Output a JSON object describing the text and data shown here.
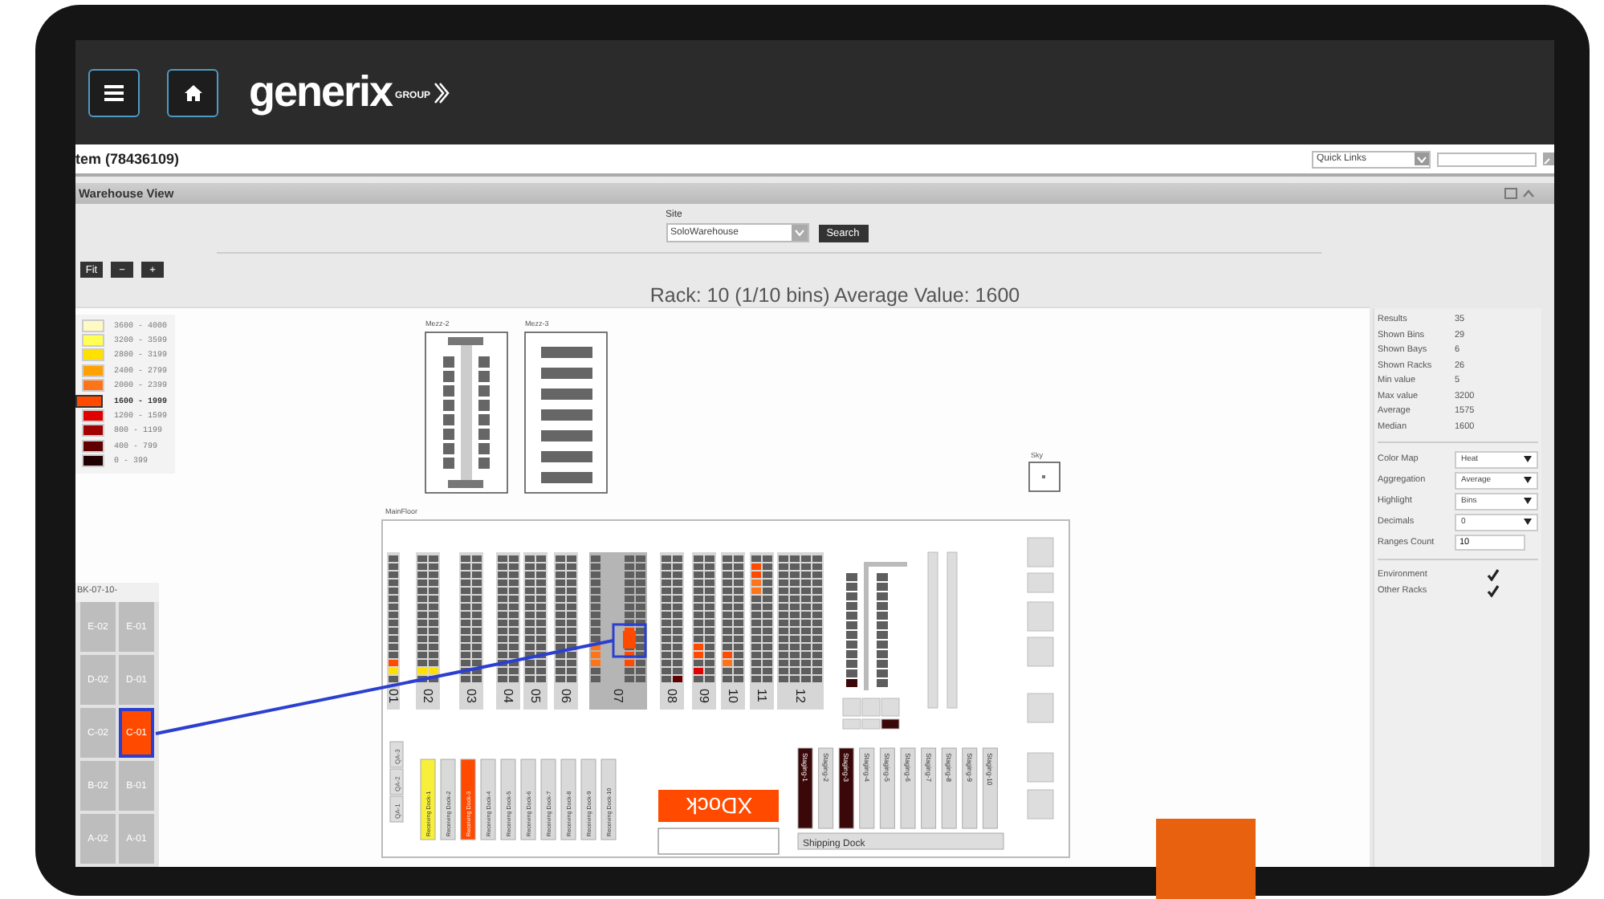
{
  "header": {
    "logo": "generix",
    "logo_suffix": "GROUP"
  },
  "title_bar": {
    "title": "tem (78436109)",
    "quick_links": "Quick Links"
  },
  "panel": {
    "title": "Warehouse View"
  },
  "site": {
    "label": "Site",
    "value": "SoloWarehouse",
    "button": "Search"
  },
  "zoom_buttons": [
    "Fit",
    "−",
    "+"
  ],
  "rack_title": "Rack: 10 (1/10 bins)  Average Value: 1600",
  "legend": [
    {
      "range": "3600 - 4000",
      "color": "#fff9c4",
      "selected": false
    },
    {
      "range": "3200 - 3599",
      "color": "#ffff55",
      "selected": false
    },
    {
      "range": "2800 - 3199",
      "color": "#ffe000",
      "selected": false
    },
    {
      "range": "2400 - 2799",
      "color": "#ffa200",
      "selected": false
    },
    {
      "range": "2000 - 2399",
      "color": "#ff7418",
      "selected": false
    },
    {
      "range": "1600 - 1999",
      "color": "#ff4a00",
      "selected": true
    },
    {
      "range": "1200 - 1599",
      "color": "#e00000",
      "selected": false
    },
    {
      "range": "800 - 1199",
      "color": "#a00000",
      "selected": false
    },
    {
      "range": "400 - 799",
      "color": "#600000",
      "selected": false
    },
    {
      "range": "0 - 399",
      "color": "#200000",
      "selected": false
    }
  ],
  "bin_detail": {
    "title": "BK-07-10-",
    "bins": [
      {
        "label": "E-02",
        "selected": false
      },
      {
        "label": "E-01",
        "selected": false
      },
      {
        "label": "D-02",
        "selected": false
      },
      {
        "label": "D-01",
        "selected": false
      },
      {
        "label": "C-02",
        "selected": false
      },
      {
        "label": "C-01",
        "selected": true
      },
      {
        "label": "B-02",
        "selected": false
      },
      {
        "label": "B-01",
        "selected": false
      },
      {
        "label": "A-02",
        "selected": false
      },
      {
        "label": "A-01",
        "selected": false
      }
    ]
  },
  "map": {
    "mezzanines": [
      "Mezz-2",
      "Mezz-3"
    ],
    "sky": "Sky",
    "floor_label": "MainFloor",
    "aisles": [
      "01",
      "02",
      "03",
      "04",
      "05",
      "06",
      "07",
      "08",
      "09",
      "10",
      "11",
      "12"
    ],
    "qa": [
      "QA-1",
      "QA-2",
      "QA-3"
    ],
    "receiving": [
      {
        "label": "Receiving Dock-1",
        "color": "#f6f03a"
      },
      {
        "label": "Receiving Dock-2",
        "color": "#d9d9d9"
      },
      {
        "label": "Receiving Dock-3",
        "color": "#ff4a00"
      },
      {
        "label": "Receiving Dock-4",
        "color": "#d9d9d9"
      },
      {
        "label": "Receiving Dock-5",
        "color": "#d9d9d9"
      },
      {
        "label": "Receiving Dock-6",
        "color": "#d9d9d9"
      },
      {
        "label": "Receiving Dock-7",
        "color": "#d9d9d9"
      },
      {
        "label": "Receiving Dock-8",
        "color": "#d9d9d9"
      },
      {
        "label": "Receiving Dock-9",
        "color": "#d9d9d9"
      },
      {
        "label": "Receiving Dock-10",
        "color": "#d9d9d9"
      }
    ],
    "xdock": "XDock",
    "staging": [
      {
        "label": "Staging-1",
        "color": "#3a0808"
      },
      {
        "label": "Staging-2",
        "color": "#d9d9d9"
      },
      {
        "label": "Staging-3",
        "color": "#3a0808"
      },
      {
        "label": "Staging-4",
        "color": "#d9d9d9"
      },
      {
        "label": "Staging-5",
        "color": "#d9d9d9"
      },
      {
        "label": "Staging-6",
        "color": "#d9d9d9"
      },
      {
        "label": "Staging-7",
        "color": "#d9d9d9"
      },
      {
        "label": "Staging-8",
        "color": "#d9d9d9"
      },
      {
        "label": "Staging-9",
        "color": "#d9d9d9"
      },
      {
        "label": "Staging-10",
        "color": "#d9d9d9"
      }
    ],
    "shipping": "Shipping Dock"
  },
  "stats": [
    {
      "label": "Results",
      "value": "35"
    },
    {
      "label": "Shown Bins",
      "value": "29"
    },
    {
      "label": "Shown Bays",
      "value": "6"
    },
    {
      "label": "Shown Racks",
      "value": "26"
    },
    {
      "label": "Min value",
      "value": "5"
    },
    {
      "label": "Max value",
      "value": "3200"
    },
    {
      "label": "Average",
      "value": "1575"
    },
    {
      "label": "Median",
      "value": "1600"
    }
  ],
  "settings": [
    {
      "kind": "select",
      "label": "Color Map",
      "value": "Heat"
    },
    {
      "kind": "select",
      "label": "Aggregation",
      "value": "Average"
    },
    {
      "kind": "select",
      "label": "Highlight",
      "value": "Bins"
    },
    {
      "kind": "select",
      "label": "Decimals",
      "value": "0"
    },
    {
      "kind": "input",
      "label": "Ranges Count",
      "value": "10"
    }
  ],
  "options": [
    {
      "label": "Environment",
      "checked": true
    },
    {
      "label": "Other Racks",
      "checked": true
    }
  ]
}
